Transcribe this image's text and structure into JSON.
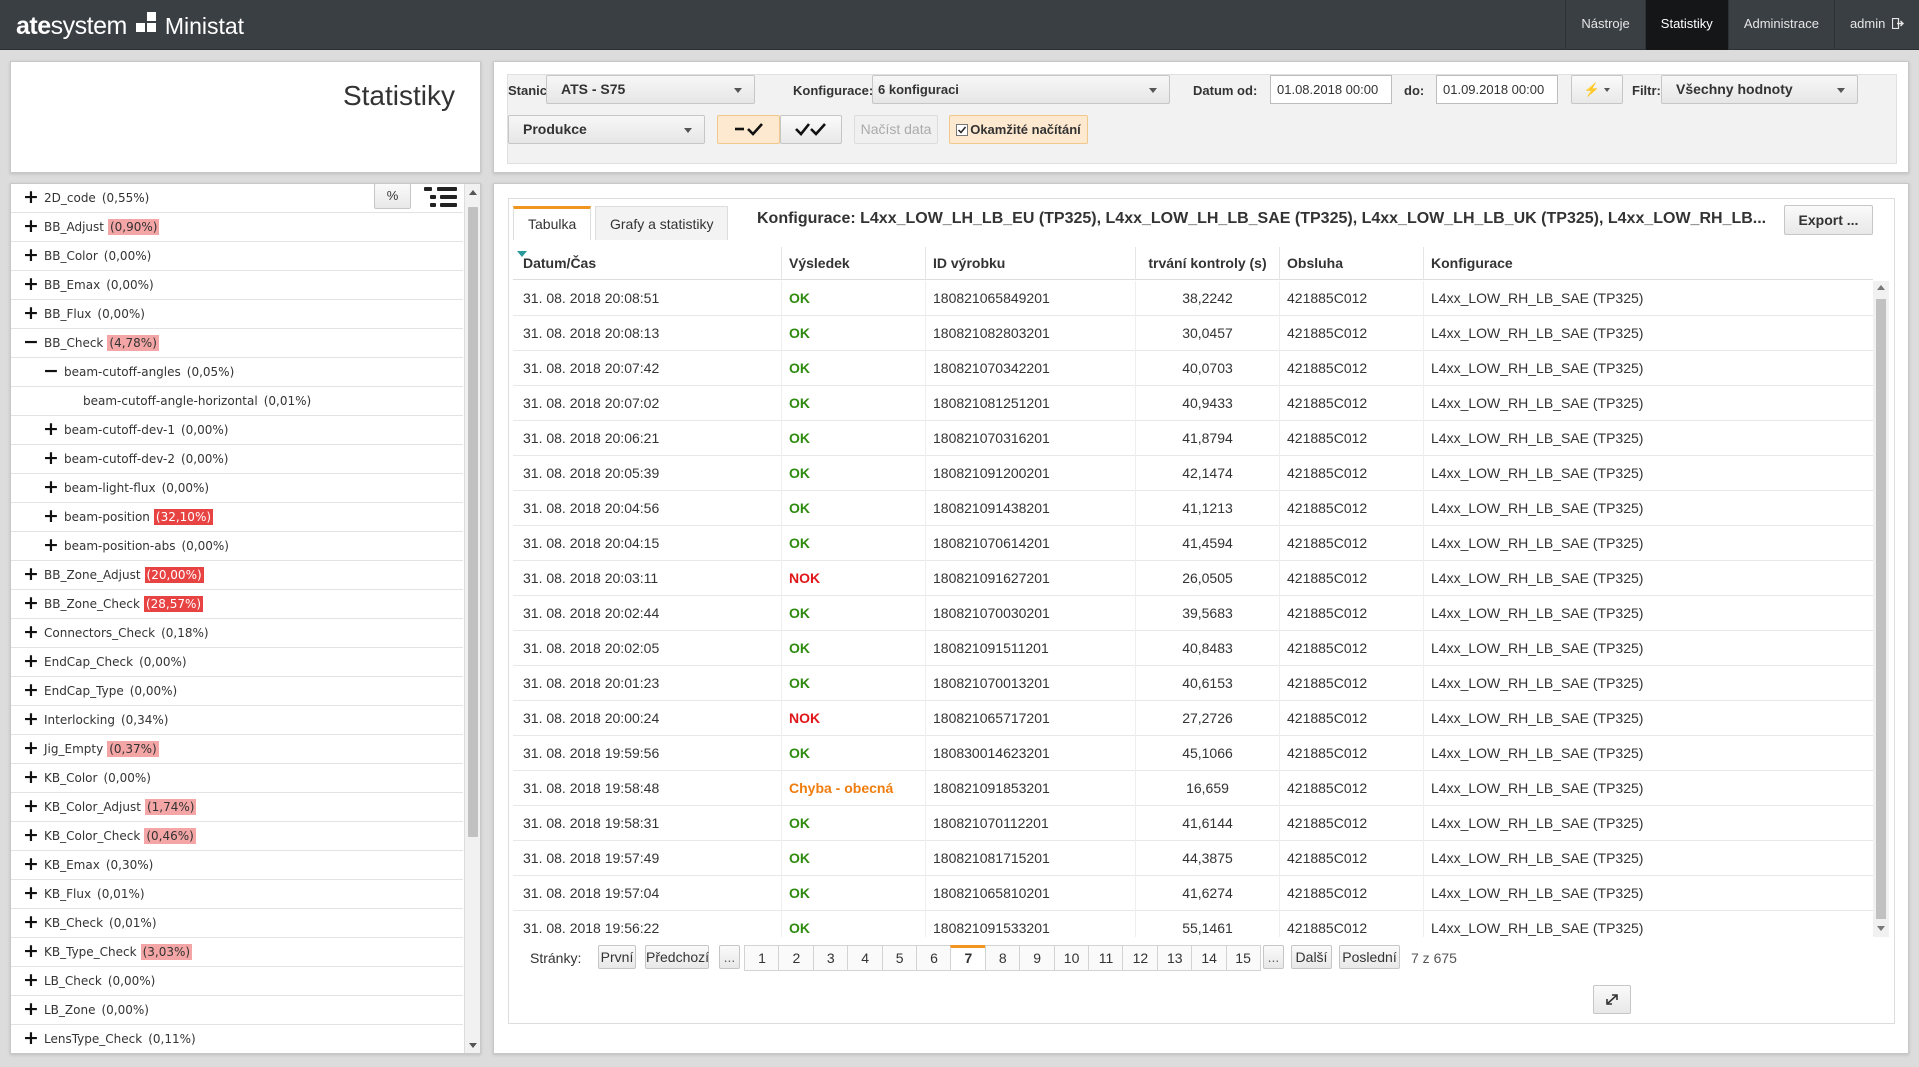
{
  "brand": {
    "name_bold": "ate",
    "name_rest": "system",
    "app": "Ministat"
  },
  "topnav": [
    {
      "label": "Nástroje",
      "active": false
    },
    {
      "label": "Statistiky",
      "active": true
    },
    {
      "label": "Administrace",
      "active": false
    },
    {
      "label": "admin",
      "icon": "logout-icon",
      "active": false
    }
  ],
  "page_title": "Statistiky",
  "filters": {
    "stanice_label": "Stanice:",
    "stanice_value": "ATS - S75",
    "konfigurace_label": "Konfigurace:",
    "konfigurace_value": "6 konfiguraci",
    "datum_od_label": "Datum od:",
    "datum_od_value": "01.08.2018 00:00",
    "do_label": "do:",
    "do_value": "01.09.2018 00:00",
    "filtr_label": "Filtr:",
    "filtr_value": "Všechny hodnoty",
    "mode_value": "Produkce",
    "load_button": "Načíst data",
    "instant_label": "Okamžité načítání",
    "instant_checked": true
  },
  "tree": {
    "percent_button": "%",
    "items": [
      {
        "toggle": "+",
        "level": 0,
        "name": "2D_code",
        "pct": "(0,55%)",
        "hl": "none"
      },
      {
        "toggle": "+",
        "level": 0,
        "name": "BB_Adjust",
        "pct": "(0,90%)",
        "hl": "pink"
      },
      {
        "toggle": "+",
        "level": 0,
        "name": "BB_Color",
        "pct": "(0,00%)",
        "hl": "none"
      },
      {
        "toggle": "+",
        "level": 0,
        "name": "BB_Emax",
        "pct": "(0,00%)",
        "hl": "none"
      },
      {
        "toggle": "+",
        "level": 0,
        "name": "BB_Flux",
        "pct": "(0,00%)",
        "hl": "none"
      },
      {
        "toggle": "−",
        "level": 0,
        "name": "BB_Check",
        "pct": "(4,78%)",
        "hl": "pink"
      },
      {
        "toggle": "−",
        "level": 1,
        "name": "beam-cutoff-angles",
        "pct": "(0,05%)",
        "hl": "none"
      },
      {
        "toggle": "",
        "level": 2,
        "name": "beam-cutoff-angle-horizontal",
        "pct": "(0,01%)",
        "hl": "none"
      },
      {
        "toggle": "+",
        "level": 1,
        "name": "beam-cutoff-dev-1",
        "pct": "(0,00%)",
        "hl": "none"
      },
      {
        "toggle": "+",
        "level": 1,
        "name": "beam-cutoff-dev-2",
        "pct": "(0,00%)",
        "hl": "none"
      },
      {
        "toggle": "+",
        "level": 1,
        "name": "beam-light-flux",
        "pct": "(0,00%)",
        "hl": "none"
      },
      {
        "toggle": "+",
        "level": 1,
        "name": "beam-position",
        "pct": "(32,10%)",
        "hl": "red"
      },
      {
        "toggle": "+",
        "level": 1,
        "name": "beam-position-abs",
        "pct": "(0,00%)",
        "hl": "none"
      },
      {
        "toggle": "+",
        "level": 0,
        "name": "BB_Zone_Adjust",
        "pct": "(20,00%)",
        "hl": "red"
      },
      {
        "toggle": "+",
        "level": 0,
        "name": "BB_Zone_Check",
        "pct": "(28,57%)",
        "hl": "red"
      },
      {
        "toggle": "+",
        "level": 0,
        "name": "Connectors_Check",
        "pct": "(0,18%)",
        "hl": "none"
      },
      {
        "toggle": "+",
        "level": 0,
        "name": "EndCap_Check",
        "pct": "(0,00%)",
        "hl": "none"
      },
      {
        "toggle": "+",
        "level": 0,
        "name": "EndCap_Type",
        "pct": "(0,00%)",
        "hl": "none"
      },
      {
        "toggle": "+",
        "level": 0,
        "name": "Interlocking",
        "pct": "(0,34%)",
        "hl": "none"
      },
      {
        "toggle": "+",
        "level": 0,
        "name": "Jig_Empty",
        "pct": "(0,37%)",
        "hl": "pink"
      },
      {
        "toggle": "+",
        "level": 0,
        "name": "KB_Color",
        "pct": "(0,00%)",
        "hl": "none"
      },
      {
        "toggle": "+",
        "level": 0,
        "name": "KB_Color_Adjust",
        "pct": "(1,74%)",
        "hl": "pink"
      },
      {
        "toggle": "+",
        "level": 0,
        "name": "KB_Color_Check",
        "pct": "(0,46%)",
        "hl": "pink"
      },
      {
        "toggle": "+",
        "level": 0,
        "name": "KB_Emax",
        "pct": "(0,30%)",
        "hl": "none"
      },
      {
        "toggle": "+",
        "level": 0,
        "name": "KB_Flux",
        "pct": "(0,01%)",
        "hl": "none"
      },
      {
        "toggle": "+",
        "level": 0,
        "name": "KB_Check",
        "pct": "(0,01%)",
        "hl": "none"
      },
      {
        "toggle": "+",
        "level": 0,
        "name": "KB_Type_Check",
        "pct": "(3,03%)",
        "hl": "pink"
      },
      {
        "toggle": "+",
        "level": 0,
        "name": "LB_Check",
        "pct": "(0,00%)",
        "hl": "none"
      },
      {
        "toggle": "+",
        "level": 0,
        "name": "LB_Zone",
        "pct": "(0,00%)",
        "hl": "none"
      },
      {
        "toggle": "+",
        "level": 0,
        "name": "LensType_Check",
        "pct": "(0,11%)",
        "hl": "none"
      }
    ]
  },
  "tabs": [
    {
      "label": "Tabulka",
      "active": true
    },
    {
      "label": "Grafy a statistiky",
      "active": false
    }
  ],
  "config_title": "Konfigurace: L4xx_LOW_LH_LB_EU (TP325), L4xx_LOW_LH_LB_SAE (TP325), L4xx_LOW_LH_LB_UK (TP325), L4xx_LOW_RH_LB...",
  "export_button": "Export ...",
  "table": {
    "columns": [
      "Datum/Čas",
      "Výsledek",
      "ID výrobku",
      "trvání kontroly (s)",
      "Obsluha",
      "Konfigurace"
    ],
    "rows": [
      [
        "31. 08. 2018 20:08:51",
        "OK",
        "180821065849201",
        "38,2242",
        "421885C012",
        "L4xx_LOW_RH_LB_SAE (TP325)"
      ],
      [
        "31. 08. 2018 20:08:13",
        "OK",
        "180821082803201",
        "30,0457",
        "421885C012",
        "L4xx_LOW_RH_LB_SAE (TP325)"
      ],
      [
        "31. 08. 2018 20:07:42",
        "OK",
        "180821070342201",
        "40,0703",
        "421885C012",
        "L4xx_LOW_RH_LB_SAE (TP325)"
      ],
      [
        "31. 08. 2018 20:07:02",
        "OK",
        "180821081251201",
        "40,9433",
        "421885C012",
        "L4xx_LOW_RH_LB_SAE (TP325)"
      ],
      [
        "31. 08. 2018 20:06:21",
        "OK",
        "180821070316201",
        "41,8794",
        "421885C012",
        "L4xx_LOW_RH_LB_SAE (TP325)"
      ],
      [
        "31. 08. 2018 20:05:39",
        "OK",
        "180821091200201",
        "42,1474",
        "421885C012",
        "L4xx_LOW_RH_LB_SAE (TP325)"
      ],
      [
        "31. 08. 2018 20:04:56",
        "OK",
        "180821091438201",
        "41,1213",
        "421885C012",
        "L4xx_LOW_RH_LB_SAE (TP325)"
      ],
      [
        "31. 08. 2018 20:04:15",
        "OK",
        "180821070614201",
        "41,4594",
        "421885C012",
        "L4xx_LOW_RH_LB_SAE (TP325)"
      ],
      [
        "31. 08. 2018 20:03:11",
        "NOK",
        "180821091627201",
        "26,0505",
        "421885C012",
        "L4xx_LOW_RH_LB_SAE (TP325)"
      ],
      [
        "31. 08. 2018 20:02:44",
        "OK",
        "180821070030201",
        "39,5683",
        "421885C012",
        "L4xx_LOW_RH_LB_SAE (TP325)"
      ],
      [
        "31. 08. 2018 20:02:05",
        "OK",
        "180821091511201",
        "40,8483",
        "421885C012",
        "L4xx_LOW_RH_LB_SAE (TP325)"
      ],
      [
        "31. 08. 2018 20:01:23",
        "OK",
        "180821070013201",
        "40,6153",
        "421885C012",
        "L4xx_LOW_RH_LB_SAE (TP325)"
      ],
      [
        "31. 08. 2018 20:00:24",
        "NOK",
        "180821065717201",
        "27,2726",
        "421885C012",
        "L4xx_LOW_RH_LB_SAE (TP325)"
      ],
      [
        "31. 08. 2018 19:59:56",
        "OK",
        "180830014623201",
        "45,1066",
        "421885C012",
        "L4xx_LOW_RH_LB_SAE (TP325)"
      ],
      [
        "31. 08. 2018 19:58:48",
        "Chyba - obecná",
        "180821091853201",
        "16,659",
        "421885C012",
        "L4xx_LOW_RH_LB_SAE (TP325)"
      ],
      [
        "31. 08. 2018 19:58:31",
        "OK",
        "180821070112201",
        "41,6144",
        "421885C012",
        "L4xx_LOW_RH_LB_SAE (TP325)"
      ],
      [
        "31. 08. 2018 19:57:49",
        "OK",
        "180821081715201",
        "44,3875",
        "421885C012",
        "L4xx_LOW_RH_LB_SAE (TP325)"
      ],
      [
        "31. 08. 2018 19:57:04",
        "OK",
        "180821065810201",
        "41,6274",
        "421885C012",
        "L4xx_LOW_RH_LB_SAE (TP325)"
      ],
      [
        "31. 08. 2018 19:56:22",
        "OK",
        "180821091533201",
        "55,1461",
        "421885C012",
        "L4xx_LOW_RH_LB_SAE (TP325)"
      ]
    ]
  },
  "pager": {
    "label": "Stránky:",
    "first": "První",
    "prev": "Předchozí",
    "ellipsis": "...",
    "pages": [
      "1",
      "2",
      "3",
      "4",
      "5",
      "6",
      "7",
      "8",
      "9",
      "10",
      "11",
      "12",
      "13",
      "14",
      "15"
    ],
    "current": "7",
    "next": "Další",
    "last": "Poslední",
    "info": "7 z 675"
  },
  "colors": {
    "accent": "#f0961e",
    "ok": "#2e8b0f",
    "nok": "#e0161a",
    "error": "#ef7d0e",
    "topbar": "#3a3f44"
  }
}
